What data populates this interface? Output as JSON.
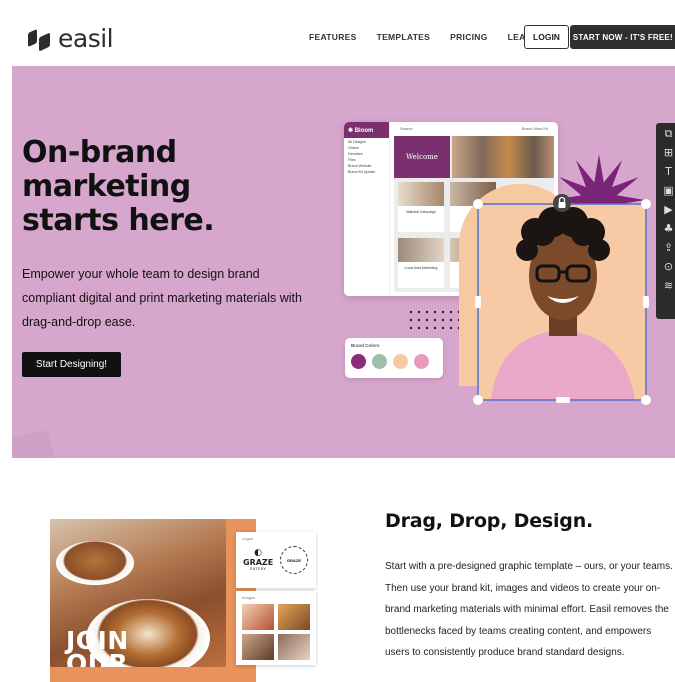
{
  "header": {
    "logo_text": "easil",
    "nav": [
      "FEATURES",
      "TEMPLATES",
      "PRICING",
      "LEARN"
    ],
    "login_label": "LOGIN",
    "start_label": "START NOW - IT'S FREE! ›"
  },
  "hero": {
    "title": "On-brand marketing starts here.",
    "subtitle": "Empower your whole team to design brand compliant digital and print marketing materials with drag-and-drop ease.",
    "cta_label": "Start Designing!",
    "bg_color": "#d7a6cd"
  },
  "mockup": {
    "brand_name": "✱ Bloom",
    "search_label": "Search",
    "share_label": "Brand View Kit",
    "side_items": [
      "All Designs",
      "Orders",
      "Favorites",
      "Files",
      "Brand Website",
      "Brand Kit Update"
    ],
    "welcome_label": "Welcome",
    "card_titles": [
      "National Campaign",
      "Local Area Marketing"
    ],
    "brand_colors_label": "Brand Colors",
    "brand_colors": [
      "#8b2a78",
      "#9fbfa9",
      "#f6c9a0",
      "#e89bbd"
    ],
    "toolbar_icons": [
      "layout-icon",
      "grid-icon",
      "text-icon",
      "image-icon",
      "video-icon",
      "elements-icon",
      "upload-icon",
      "lock-icon",
      "layers-icon"
    ]
  },
  "section2": {
    "title": "Drag, Drop, Design.",
    "body": "Start with a pre-designed graphic template – ours, or your teams. Then use your brand kit, images and videos to create your on-brand marketing materials with minimal effort. Easil removes the bottlenecks faced by teams creating content, and empowers users to consistently produce brand standard designs.",
    "image_text": "JOIN OUR TEAM",
    "logos_label": "Logos",
    "images_label": "Images",
    "graze_name": "GRAZE",
    "graze_sub": "EATERY"
  }
}
